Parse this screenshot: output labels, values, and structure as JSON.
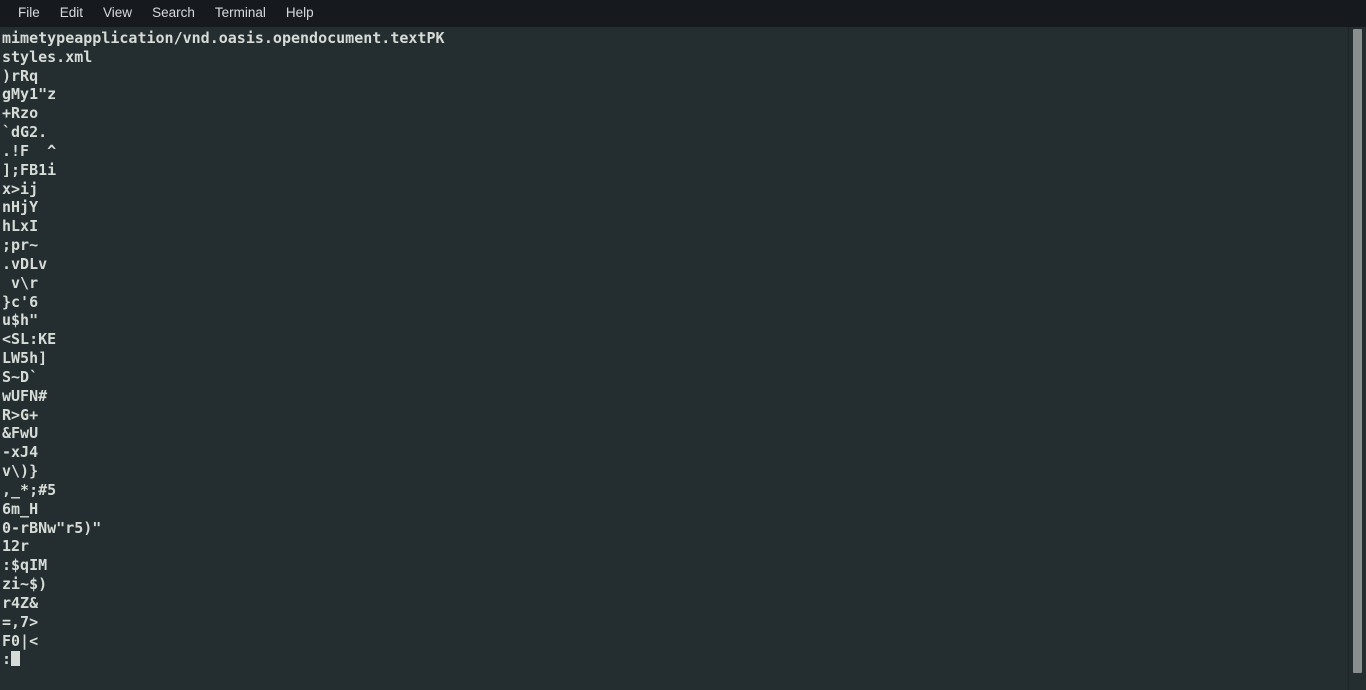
{
  "window": {
    "title": "Terminal",
    "background_color": "#242d30",
    "menubar_color": "#16191d",
    "text_color": "#d6dbd5"
  },
  "menubar": {
    "items": [
      {
        "label": "File"
      },
      {
        "label": "Edit"
      },
      {
        "label": "View"
      },
      {
        "label": "Search"
      },
      {
        "label": "Terminal"
      },
      {
        "label": "Help"
      }
    ]
  },
  "terminal": {
    "cursor": {
      "style": "block",
      "color": "#d6dbd5"
    },
    "lines": [
      "mimetypeapplication/vnd.oasis.opendocument.textPK",
      "styles.xml",
      ")rRq",
      "gMy1\"z",
      "+Rzo",
      "`dG2.",
      ".!F  ^",
      "];FB1i",
      "x>ij",
      "nHjY",
      "hLxI",
      ";pr~",
      ".vDLv",
      " v\\r",
      "}c'6",
      "u$h\"",
      "<SL:KE",
      "LW5h]",
      "S~D`",
      "wUFN#",
      "R>G+",
      "&FwU",
      "-xJ4",
      "v\\)}",
      ",_*;#5",
      "6m_H",
      "0-rBNw\"r5)\"",
      "12r",
      ":$qIM",
      "zi~$)",
      "r4Z&",
      "=,7>",
      "F0|<"
    ],
    "prompt_line": ":"
  },
  "scrollbar": {
    "orientation": "vertical",
    "thumb_color": "#8a8e8f"
  }
}
